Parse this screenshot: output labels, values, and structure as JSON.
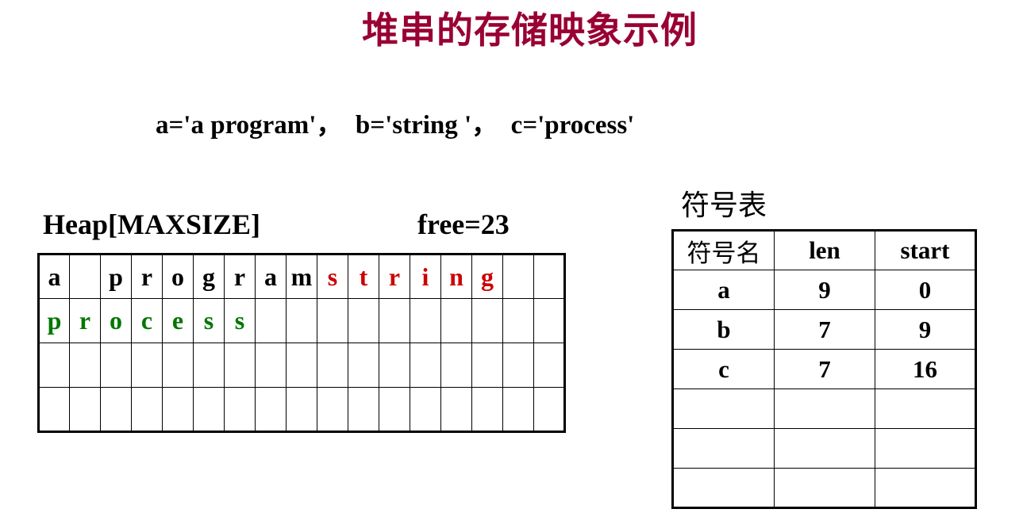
{
  "title": "堆串的存储映象示例",
  "assignment": "a='a program'，  b='string '，  c='process'",
  "heap_label": "Heap[MAXSIZE]",
  "free_label": "free=23",
  "heap_rows": [
    [
      "a",
      "",
      "p",
      "r",
      "o",
      "g",
      "r",
      "a",
      "m",
      "s",
      "t",
      "r",
      "i",
      "n",
      "g",
      "",
      ""
    ],
    [
      "p",
      "r",
      "o",
      "c",
      "e",
      "s",
      "s",
      "",
      "",
      "",
      "",
      "",
      "",
      "",
      "",
      "",
      ""
    ],
    [
      "",
      "",
      "",
      "",
      "",
      "",
      "",
      "",
      "",
      "",
      "",
      "",
      "",
      "",
      "",
      "",
      ""
    ],
    [
      "",
      "",
      "",
      "",
      "",
      "",
      "",
      "",
      "",
      "",
      "",
      "",
      "",
      "",
      "",
      "",
      ""
    ]
  ],
  "colors": {
    "title": "#990033",
    "string_a": "#000000",
    "string_b": "#cc0000",
    "string_c": "#007700"
  },
  "symbol_table": {
    "caption": "符号表",
    "headers": [
      "符号名",
      "len",
      "start"
    ],
    "rows": [
      [
        "a",
        "9",
        "0"
      ],
      [
        "b",
        "7",
        "9"
      ],
      [
        "c",
        "7",
        "16"
      ],
      [
        "",
        "",
        ""
      ],
      [
        "",
        "",
        ""
      ],
      [
        "",
        "",
        ""
      ]
    ]
  }
}
